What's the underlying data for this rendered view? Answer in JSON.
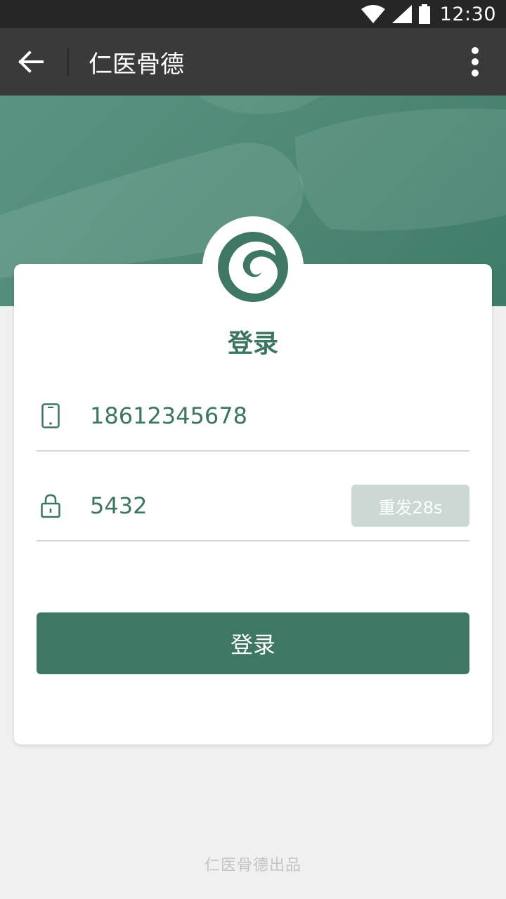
{
  "status_bar": {
    "time": "12:30"
  },
  "app_bar": {
    "title": "仁医骨德"
  },
  "login": {
    "title": "登录",
    "phone_value": "18612345678",
    "code_value": "5432",
    "resend_label": "重发28s",
    "submit_label": "登录"
  },
  "footer": {
    "text": "仁医骨德出品"
  },
  "icons": {
    "back": "arrow-left-icon",
    "more": "more-vertical-icon",
    "phone": "phone-icon",
    "lock": "lock-icon",
    "logo": "swirl-logo"
  },
  "colors": {
    "accent": "#3e7764",
    "hero": "#4f8a77",
    "resend_disabled": "#ccd8d3"
  }
}
